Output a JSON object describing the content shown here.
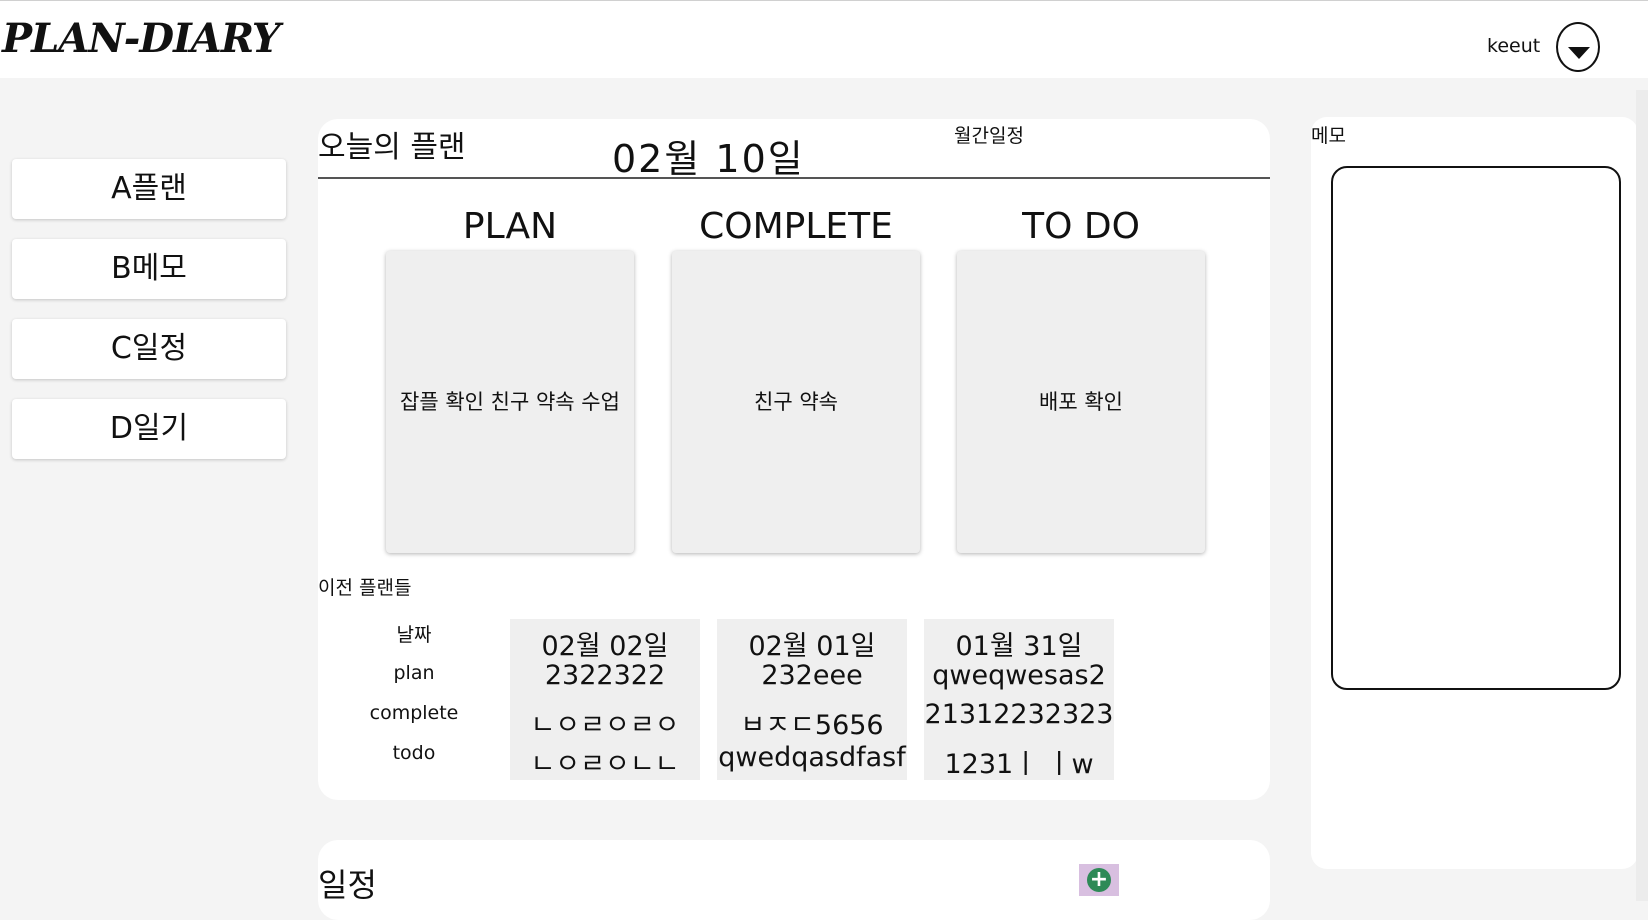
{
  "header": {
    "logo": "PLAN-DIARY",
    "username": "keeut",
    "menu_icon": "chevron-down-icon"
  },
  "sidebar": {
    "items": [
      {
        "label": "A플랜"
      },
      {
        "label": "B메모"
      },
      {
        "label": "C일정"
      },
      {
        "label": "D일기"
      }
    ]
  },
  "today": {
    "title": "오늘의 플랜",
    "date": "02월  10일",
    "monthly_link": "월간일정",
    "columns": [
      {
        "title": "PLAN",
        "content": "잡플 확인 친구 약속 수업"
      },
      {
        "title": "COMPLETE",
        "content": "친구 약속"
      },
      {
        "title": "TO DO",
        "content": "배포 확인"
      }
    ]
  },
  "previous": {
    "title": "이전 플랜들",
    "row_labels": [
      "날짜",
      "plan",
      "complete",
      "todo"
    ],
    "entries": [
      {
        "date": "02월  02일",
        "plan": "2322322",
        "complete": "ㄴㅇㄹㅇㄹㅇ",
        "todo": "ㄴㅇㄹㅇㄴㄴ"
      },
      {
        "date": "02월  01일",
        "plan": "232eee",
        "complete": "ㅂㅈㄷ5656",
        "todo": "qwedqasdfasf"
      },
      {
        "date": "01월  31일",
        "plan": "qweqwesas2",
        "complete": "21312232323",
        "todo": "1231ㅣ ㅣw"
      }
    ]
  },
  "memo": {
    "label": "메모"
  },
  "schedule": {
    "title": "일정",
    "add_icon": "plus-circle-icon",
    "add_color": "#2e8a57"
  }
}
